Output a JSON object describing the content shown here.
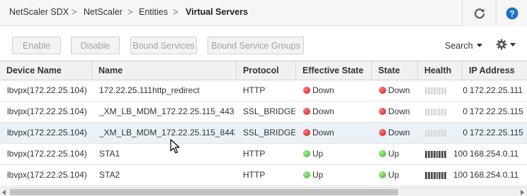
{
  "breadcrumb": {
    "items": [
      "NetScaler SDX",
      "NetScaler",
      "Entities"
    ],
    "current": "Virtual Servers",
    "separator": ">"
  },
  "header_actions": {
    "refresh_icon": "refresh-icon",
    "help_icon": "help-icon",
    "help_label": "?"
  },
  "toolbar": {
    "buttons": [
      "Enable",
      "Disable",
      "Bound Services",
      "Bound Service Groups"
    ],
    "search_label": "Search",
    "settings_icon": "gear-icon"
  },
  "table": {
    "columns": [
      "Device Name",
      "Name",
      "Protocol",
      "Effective State",
      "State",
      "Health",
      "IP Address"
    ],
    "rows": [
      {
        "device": "lbvpx(172.22.25.104)",
        "name": "172.22.25.111http_redirect",
        "protocol": "HTTP",
        "effective_state": "Down",
        "state": "Down",
        "health_value": "0",
        "health_fraction": 0,
        "ip": "172.22.25.111"
      },
      {
        "device": "lbvpx(172.22.25.104)",
        "name": "_XM_LB_MDM_172.22.25.115_443",
        "protocol": "SSL_BRIDGE",
        "effective_state": "Down",
        "state": "Down",
        "health_value": "0",
        "health_fraction": 0,
        "ip": "172.22.25.115"
      },
      {
        "device": "lbvpx(172.22.25.104)",
        "name": "_XM_LB_MDM_172.22.25.115_8443",
        "protocol": "SSL_BRIDGE",
        "effective_state": "Down",
        "state": "Down",
        "health_value": "0",
        "health_fraction": 0,
        "ip": "172.22.25.115"
      },
      {
        "device": "lbvpx(172.22.25.104)",
        "name": "STA1",
        "protocol": "HTTP",
        "effective_state": "Up",
        "state": "Up",
        "health_value": "100",
        "health_fraction": 1,
        "ip": "168.254.0.11"
      },
      {
        "device": "lbvpx(172.22.25.104)",
        "name": "STA2",
        "protocol": "HTTP",
        "effective_state": "Up",
        "state": "Up",
        "health_value": "100",
        "health_fraction": 1,
        "ip": "168.254.0.11"
      }
    ],
    "selected_row": 2
  },
  "colors": {
    "down": "#d01818",
    "up": "#3fae2a",
    "accent": "#1a73c8",
    "selected_row": "#eaf2f8"
  }
}
